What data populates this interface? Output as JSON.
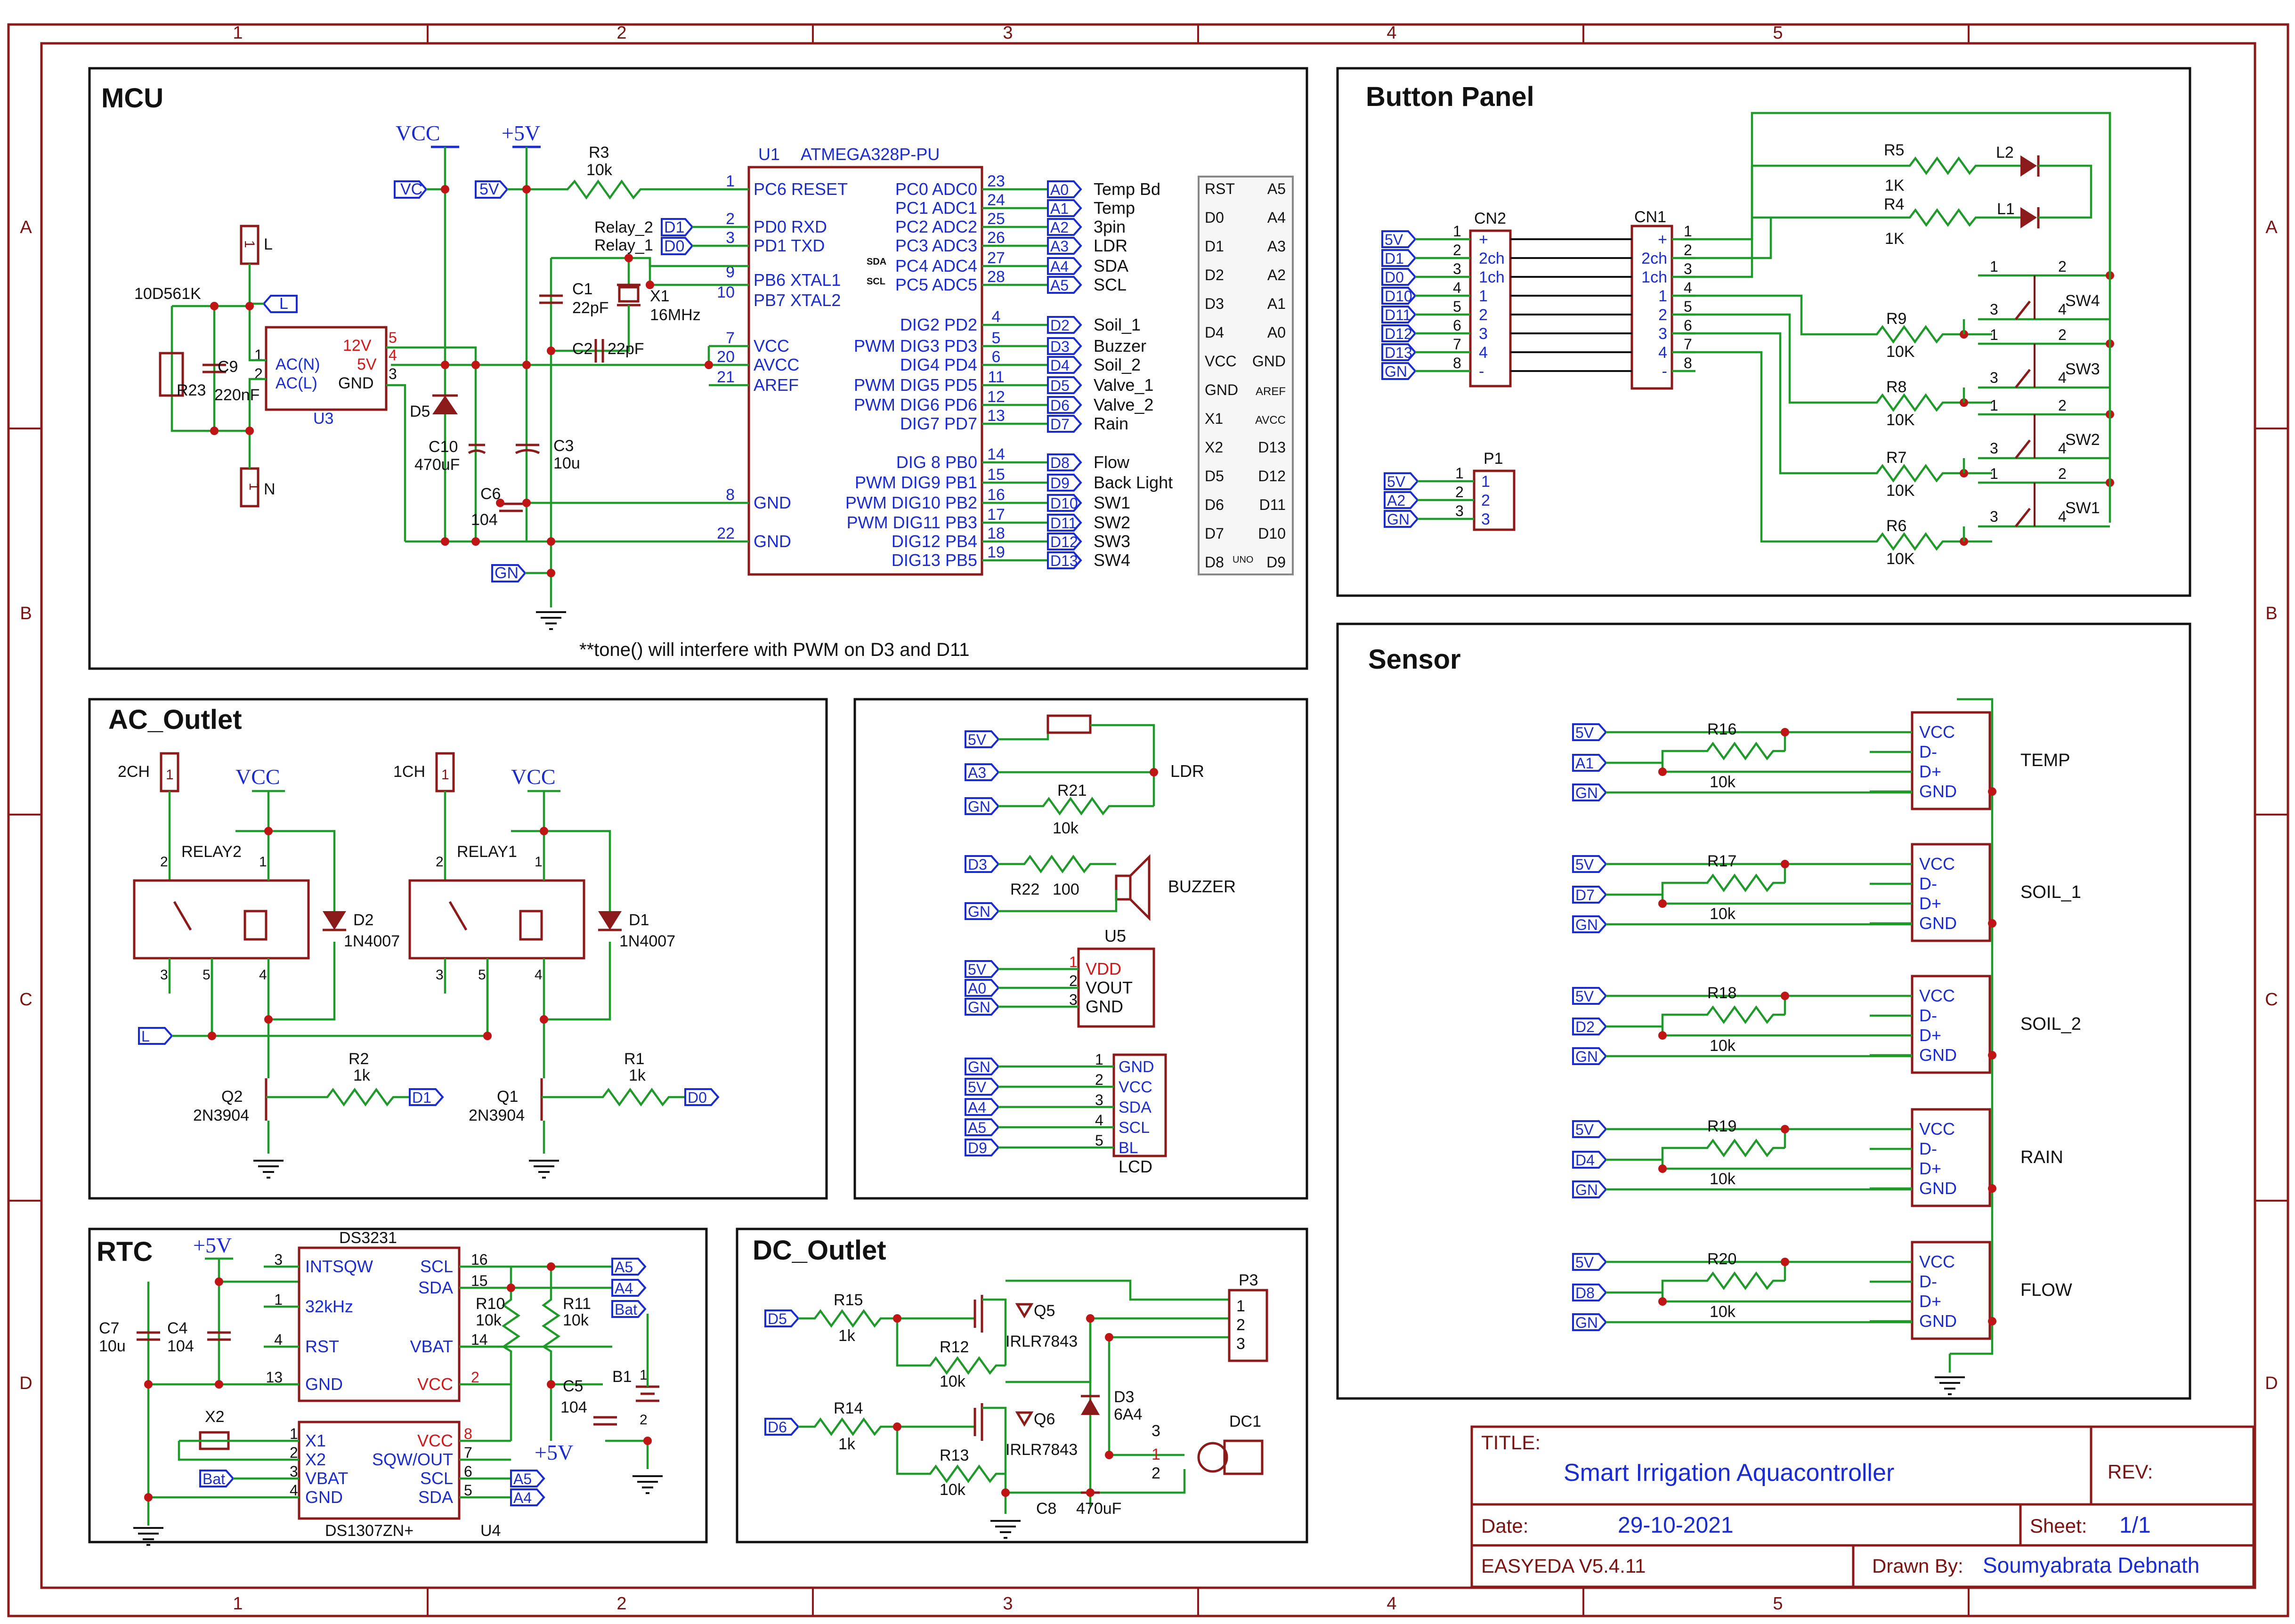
{
  "sheet": {
    "col_numbers": [
      "1",
      "2",
      "3",
      "4",
      "5"
    ],
    "row_letters": [
      "A",
      "B",
      "C",
      "D"
    ]
  },
  "sections": {
    "mcu": "MCU",
    "button_panel": "Button Panel",
    "ac_outlet": "AC_Outlet",
    "sensor": "Sensor",
    "rtc": "RTC",
    "dc_outlet": "DC_Outlet"
  },
  "mcu": {
    "note": "**tone() will interfere with PWM on D3 and D11",
    "u1_ref": "U1",
    "u1_name": "ATMEGA328P-PU",
    "left_pins": [
      {
        "num": "1",
        "name": "PC6 RESET"
      },
      {
        "num": "2",
        "name": "PD0 RXD"
      },
      {
        "num": "3",
        "name": "PD1 TXD"
      },
      {
        "num": "9",
        "name": "PB6 XTAL1"
      },
      {
        "num": "10",
        "name": "PB7 XTAL2"
      },
      {
        "num": "7",
        "name": "VCC"
      },
      {
        "num": "20",
        "name": "AVCC"
      },
      {
        "num": "21",
        "name": "AREF"
      },
      {
        "num": "8",
        "name": "GND"
      },
      {
        "num": "22",
        "name": "GND"
      }
    ],
    "right_pins": [
      {
        "num": "23",
        "name": "PC0 ADC0",
        "net": "A0",
        "label": "Temp Bd"
      },
      {
        "num": "24",
        "name": "PC1 ADC1",
        "net": "A1",
        "label": "Temp"
      },
      {
        "num": "25",
        "name": "PC2 ADC2",
        "net": "A2",
        "label": "3pin"
      },
      {
        "num": "26",
        "name": "PC3 ADC3",
        "net": "A3",
        "label": "LDR"
      },
      {
        "num": "27",
        "name": "PC4 ADC4",
        "net": "A4",
        "label": "SDA"
      },
      {
        "num": "28",
        "name": "PC5 ADC5",
        "net": "A5",
        "label": "SCL"
      },
      {
        "num": "4",
        "name": "DIG2 PD2",
        "net": "D2",
        "label": "Soil_1"
      },
      {
        "num": "5",
        "name": "PWM DIG3 PD3",
        "net": "D3",
        "label": "Buzzer"
      },
      {
        "num": "6",
        "name": "DIG4 PD4",
        "net": "D4",
        "label": "Soil_2"
      },
      {
        "num": "11",
        "name": "PWM DIG5 PD5",
        "net": "D5",
        "label": "Valve_1"
      },
      {
        "num": "12",
        "name": "PWM DIG6 PD6",
        "net": "D6",
        "label": "Valve_2"
      },
      {
        "num": "13",
        "name": "DIG7 PD7",
        "net": "D7",
        "label": "Rain"
      },
      {
        "num": "14",
        "name": "DIG 8 PB0",
        "net": "D8",
        "label": "Flow"
      },
      {
        "num": "15",
        "name": "PWM DIG9 PB1",
        "net": "D9",
        "label": "Back Light"
      },
      {
        "num": "16",
        "name": "PWM DIG10 PB2",
        "net": "D10",
        "label": "SW1"
      },
      {
        "num": "17",
        "name": "PWM DIG11 PB3",
        "net": "D11",
        "label": "SW2"
      },
      {
        "num": "18",
        "name": "DIG12 PB4",
        "net": "D12",
        "label": "SW3"
      },
      {
        "num": "19",
        "name": "DIG13 PB5",
        "net": "D13",
        "label": "SW4"
      }
    ],
    "sda_mark": "SDA",
    "scl_mark": "SCL",
    "vcc_label": "VCC",
    "p5v_label": "+5V",
    "r3": {
      "ref": "R3",
      "val": "10k"
    },
    "relay2_label": "Relay_2",
    "relay1_label": "Relay_1",
    "c1": {
      "ref": "C1",
      "val": "22pF"
    },
    "c2": {
      "ref": "C2",
      "val": "22pF"
    },
    "x1": {
      "ref": "X1",
      "val": "16MHz"
    },
    "u3": {
      "ref": "U3",
      "pin1": "AC(N)",
      "pin2": "AC(L)",
      "pin3": "GND",
      "v12": "12V",
      "v5": "5V",
      "n1": "1",
      "n2": "2",
      "n3": "3",
      "n4": "4",
      "n5": "5"
    },
    "varistor": {
      "ref": "R23",
      "val": "10D561K"
    },
    "c9": {
      "ref": "C9",
      "val": "220nF"
    },
    "d5": "D5",
    "c10": {
      "ref": "C10",
      "val": "470uF"
    },
    "c6": {
      "ref": "C6",
      "val": "104"
    },
    "c3": {
      "ref": "C3",
      "val": "10u"
    },
    "l_label": "L",
    "n_label": "N",
    "conn_pin": "1",
    "nets": {
      "vcc": "VC",
      "v5": "5V",
      "gn": "GN",
      "d1": "D1",
      "d0": "D0",
      "l": "L"
    },
    "uno_left": [
      "RST",
      "D0",
      "D1",
      "D2",
      "D3",
      "D4",
      "VCC",
      "GND",
      "X1",
      "X2",
      "D5",
      "D6",
      "D7",
      "D8"
    ],
    "uno_right": [
      "A5",
      "A4",
      "A3",
      "A2",
      "A1",
      "A0",
      "GND",
      "AREF",
      "AVCC",
      "D13",
      "D12",
      "D11",
      "D10",
      "D9"
    ],
    "uno_mark": "UNO"
  },
  "button_panel": {
    "cn2": {
      "ref": "CN2",
      "nets": [
        "5V",
        "D1",
        "D0",
        "D10",
        "D11",
        "D12",
        "D13",
        "GN"
      ],
      "nums": [
        "1",
        "2",
        "3",
        "4",
        "5",
        "6",
        "7",
        "8"
      ],
      "labels": [
        "+",
        "2ch",
        "1ch",
        "1",
        "2",
        "3",
        "4",
        "-"
      ]
    },
    "cn1": {
      "ref": "CN1",
      "labels": [
        "+",
        "2ch",
        "1ch",
        "1",
        "2",
        "3",
        "4",
        "-"
      ],
      "nums": [
        "1",
        "2",
        "3",
        "4",
        "5",
        "6",
        "7",
        "8"
      ]
    },
    "p1": {
      "ref": "P1",
      "nets": [
        "5V",
        "A2",
        "GN"
      ],
      "nums": [
        "1",
        "2",
        "3"
      ]
    },
    "r5": {
      "ref": "R5",
      "val": "1K"
    },
    "r4": {
      "ref": "R4",
      "val": "1K"
    },
    "l2": "L2",
    "l1": "L1",
    "r9": {
      "ref": "R9",
      "val": "10K"
    },
    "r8": {
      "ref": "R8",
      "val": "10K"
    },
    "r7": {
      "ref": "R7",
      "val": "10K"
    },
    "r6": {
      "ref": "R6",
      "val": "10K"
    },
    "sw": [
      "SW4",
      "SW3",
      "SW2",
      "SW1"
    ],
    "sw_pins": [
      "1",
      "2",
      "3",
      "4"
    ]
  },
  "ac_outlet": {
    "relay2": {
      "ref": "RELAY2",
      "conn": "2CH"
    },
    "relay1": {
      "ref": "RELAY1",
      "conn": "1CH"
    },
    "d2": {
      "ref": "D2",
      "val": "1N4007"
    },
    "d1": {
      "ref": "D1",
      "val": "1N4007"
    },
    "q2": {
      "ref": "Q2",
      "val": "2N3904"
    },
    "q1": {
      "ref": "Q1",
      "val": "2N3904"
    },
    "r2": {
      "ref": "R2",
      "val": "1k"
    },
    "r1": {
      "ref": "R1",
      "val": "1k"
    },
    "vcc": "VCC",
    "relay_pins": [
      "2",
      "3",
      "5",
      "4",
      "1"
    ],
    "nets": {
      "l": "L",
      "d1": "D1",
      "d0": "D0"
    }
  },
  "middle": {
    "ldr": "LDR",
    "r21": {
      "ref": "R21",
      "val": "10k"
    },
    "r22": {
      "ref": "R22",
      "val": "100"
    },
    "buzzer": "BUZZER",
    "u5": {
      "ref": "U5",
      "pins": [
        "VDD",
        "VOUT",
        "GND"
      ],
      "nums": [
        "1",
        "2",
        "3"
      ]
    },
    "lcd": {
      "ref": "LCD",
      "pins": [
        "GND",
        "VCC",
        "SDA",
        "SCL",
        "BL"
      ],
      "nums": [
        "1",
        "2",
        "3",
        "4",
        "5"
      ],
      "nets": [
        "GN",
        "5V",
        "A4",
        "A5",
        "D9"
      ]
    },
    "nets": {
      "v5": "5V",
      "a3": "A3",
      "gn": "GN",
      "d3": "D3",
      "a0": "A0"
    }
  },
  "sensor": {
    "pins": [
      "VCC",
      "D-",
      "D+",
      "GND"
    ],
    "rows": [
      {
        "ref": "R16",
        "val": "10k",
        "net": "A1",
        "name": "TEMP"
      },
      {
        "ref": "R17",
        "val": "10k",
        "net": "D7",
        "name": "SOIL_1"
      },
      {
        "ref": "R18",
        "val": "10k",
        "net": "D2",
        "name": "SOIL_2"
      },
      {
        "ref": "R19",
        "val": "10k",
        "net": "D4",
        "name": "RAIN"
      },
      {
        "ref": "R20",
        "val": "10k",
        "net": "D8",
        "name": "FLOW"
      }
    ],
    "v5": "5V",
    "gn": "GN"
  },
  "rtc": {
    "p5v": "+5V",
    "ds3231": {
      "ref": "DS3231",
      "pins_l": [
        "INTSQW",
        "32kHz",
        "RST",
        "GND"
      ],
      "nums_l": [
        "3",
        "1",
        "4",
        "13"
      ],
      "pins_r": [
        "SCL",
        "SDA",
        "VBAT",
        "VCC"
      ],
      "nums_r": [
        "16",
        "15",
        "14",
        "2"
      ]
    },
    "ds1307": {
      "ref": "DS1307ZN+",
      "u": "U4",
      "pins_l": [
        "X1",
        "X2",
        "VBAT",
        "GND"
      ],
      "nums_l": [
        "1",
        "2",
        "3",
        "4"
      ],
      "pins_r": [
        "VCC",
        "SQW/OUT",
        "SCL",
        "SDA"
      ],
      "nums_r": [
        "8",
        "7",
        "6",
        "5"
      ]
    },
    "c7": {
      "ref": "C7",
      "val": "10u"
    },
    "c4": {
      "ref": "C4",
      "val": "104"
    },
    "c5": {
      "ref": "C5",
      "val": "104"
    },
    "r10": {
      "ref": "R10",
      "val": "10k"
    },
    "r11": {
      "ref": "R11",
      "val": "10k"
    },
    "x2": "X2",
    "b1": "B1",
    "nets": {
      "a5": "A5",
      "a4": "A4",
      "bat": "Bat"
    },
    "batt_pins": [
      "1",
      "2"
    ]
  },
  "dc_outlet": {
    "r15": {
      "ref": "R15",
      "val": "1k"
    },
    "r14": {
      "ref": "R14",
      "val": "1k"
    },
    "r12": {
      "ref": "R12",
      "val": "10k"
    },
    "r13": {
      "ref": "R13",
      "val": "10k"
    },
    "q5": {
      "ref": "Q5",
      "val": "IRLR7843"
    },
    "q6": {
      "ref": "Q6",
      "val": "IRLR7843"
    },
    "d3": {
      "ref": "D3",
      "val": "6A4"
    },
    "c8": {
      "ref": "C8",
      "val": "470uF"
    },
    "p3": {
      "ref": "P3",
      "pins": [
        "1",
        "2",
        "3"
      ]
    },
    "dc1": {
      "ref": "DC1",
      "pins": [
        "3",
        "1",
        "2"
      ]
    },
    "nets": {
      "d5": "D5",
      "d6": "D6"
    }
  },
  "title_block": {
    "title_label": "TITLE:",
    "title": "Smart Irrigation Aquacontroller",
    "rev_label": "REV:",
    "date_label": "Date:",
    "date": "29-10-2021",
    "sheet_label": "Sheet:",
    "sheet": "1/1",
    "tool": "EASYEDA V5.4.11",
    "drawn_label": "Drawn By:",
    "drawn_by": "Soumyabrata Debnath"
  }
}
